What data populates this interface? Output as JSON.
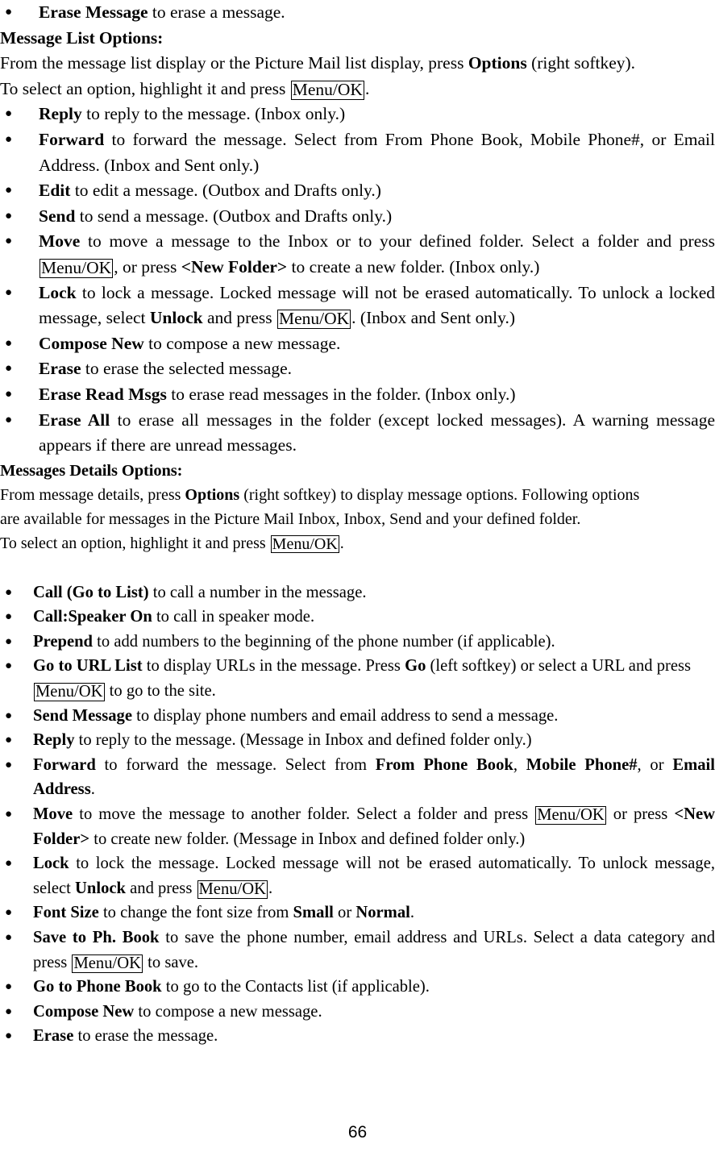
{
  "page": {
    "number": "66",
    "document_type": "user-manual-page"
  },
  "intro_bullet": {
    "term": "Erase Message",
    "rest": " to erase a message."
  },
  "section_message_list": {
    "heading": "Message List Options:",
    "intro_line_1_a": "From the message list display or the Picture Mail list display, press ",
    "intro_line_1_term": "Options",
    "intro_line_1_b": " (right softkey).",
    "intro_line_2_a": "To select an option, highlight it and press ",
    "intro_line_2_key": "Menu/OK",
    "intro_line_2_b": ".",
    "bullets": [
      {
        "term": "Reply",
        "rest": " to reply to the message. (Inbox only.)"
      },
      {
        "term": "Forward",
        "rest": " to forward the message. Select from From Phone Book, Mobile Phone#, or Email Address. (Inbox and Sent only.)"
      },
      {
        "term": "Edit",
        "rest": " to edit a message. (Outbox and Drafts only.)"
      },
      {
        "term": "Send",
        "rest": " to send a message. (Outbox and Drafts only.)"
      },
      {
        "term": "Move",
        "rest_a": " to move a message to the Inbox or to your defined folder. Select a folder and press ",
        "key": "Menu/OK",
        "rest_b": ", or press ",
        "term_2": "<New Folder>",
        "rest_c": " to create a new folder. (Inbox only.)"
      },
      {
        "term": "Lock",
        "rest_a": " to lock a message. Locked message will not be erased automatically. To unlock a locked message, select ",
        "term_2": "Unlock",
        "rest_b": " and press ",
        "key": "Menu/OK",
        "rest_c": ". (Inbox and Sent only.)"
      },
      {
        "term": "Compose New",
        "rest": " to compose a new message."
      },
      {
        "term": "Erase",
        "rest": " to erase the selected message."
      },
      {
        "term": "Erase Read Msgs",
        "rest": " to erase read messages in the folder. (Inbox only.)"
      },
      {
        "term": "Erase All",
        "rest": " to erase all messages in the folder (except locked messages). A warning message appears if there are unread messages."
      }
    ]
  },
  "section_message_details": {
    "heading": "Messages Details Options:",
    "intro_line_1_a": "From message details, press ",
    "intro_line_1_term": "Options",
    "intro_line_1_b": " (right softkey) to display message options. Following options",
    "intro_line_2": "are available for messages in the Picture Mail Inbox, Inbox, Send and your defined folder.",
    "intro_line_3_a": "To select an option, highlight it and press ",
    "intro_line_3_key": "Menu/OK",
    "intro_line_3_b": ".",
    "bullets": [
      {
        "term": "Call (Go to List)",
        "rest": " to call a number in the message."
      },
      {
        "term": "Call:Speaker On",
        "rest": " to call in speaker mode."
      },
      {
        "term": "Prepend",
        "rest": " to add numbers to the beginning of the phone number (if applicable)."
      },
      {
        "term": "Go to URL List",
        "rest_a": " to display URLs in the message. Press ",
        "term_2": "Go",
        "rest_b": " (left softkey) or select a URL and press ",
        "key": "Menu/OK",
        "rest_c": " to go to the site."
      },
      {
        "term": "Send Message",
        "rest": " to display phone numbers and email address to send a message."
      },
      {
        "term": "Reply",
        "rest": " to reply to the message. (Message in Inbox and defined folder only.)"
      },
      {
        "term": "Forward",
        "rest_a": " to forward the message. Select from ",
        "term_2": "From Phone Book",
        "rest_b": ", ",
        "term_3": "Mobile Phone#",
        "rest_c": ", or ",
        "term_4": "Email Address",
        "rest_d": "."
      },
      {
        "term": "Move",
        "rest_a": " to move the message to another folder. Select a folder and press ",
        "key": "Menu/OK",
        "rest_b": " or press ",
        "term_2": "<New Folder>",
        "rest_c": " to create new folder. (Message in Inbox and defined folder only.)"
      },
      {
        "term": "Lock",
        "rest_a": " to lock the message. Locked message will not be erased automatically. To unlock message, select ",
        "term_2": "Unlock",
        "rest_b": " and press ",
        "key": "Menu/OK",
        "rest_c": "."
      },
      {
        "term": "Font Size",
        "rest_a": " to change the font size from ",
        "term_2": "Small",
        "rest_b": " or ",
        "term_3": "Normal",
        "rest_c": "."
      },
      {
        "term": "Save to Ph. Book",
        "rest_a": " to save the phone number, email address and URLs. Select a data category and press ",
        "key": "Menu/OK",
        "rest_b": " to save."
      },
      {
        "term": "Go to Phone Book",
        "rest": " to go to the Contacts list (if applicable)."
      },
      {
        "term": "Compose New",
        "rest": " to compose a new message."
      },
      {
        "term": "Erase",
        "rest": " to erase the message."
      }
    ]
  }
}
